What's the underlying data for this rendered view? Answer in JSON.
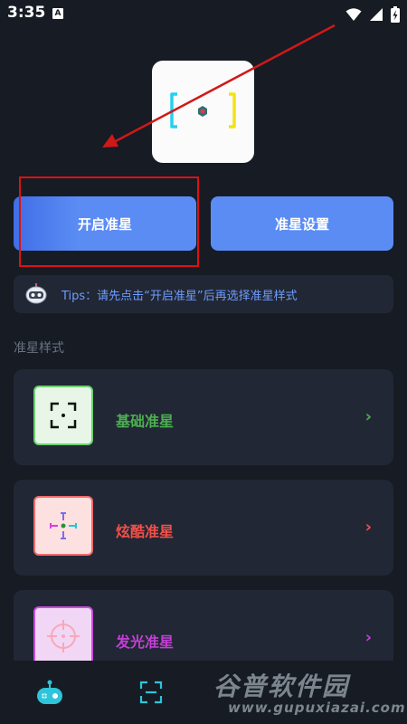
{
  "status_bar": {
    "time": "3:35",
    "notification_badge": "A"
  },
  "buttons": {
    "start_crosshair": "开启准星",
    "crosshair_settings": "准星设置"
  },
  "tips": {
    "text": "Tips：请先点击“开启准星”后再选择准星样式"
  },
  "section": {
    "title": "准星样式"
  },
  "styles": [
    {
      "title": "基础准星",
      "color": "#4caf50",
      "icon_bg": "#e7f6e7",
      "icon_border": "#6fcf6f",
      "chevron": "›"
    },
    {
      "title": "炫酷准星",
      "color": "#f0504a",
      "icon_bg": "#fde0e0",
      "icon_border": "#f06b6b",
      "chevron": "›"
    },
    {
      "title": "发光准星",
      "color": "#c23fd4",
      "icon_bg": "#f1d7f5",
      "icon_border": "#c94ee0",
      "chevron": "›"
    }
  ],
  "watermark": {
    "brand": "谷普软件园",
    "url": "www.gupuxiazai.com"
  },
  "colors": {
    "accent": "#5b8cf4",
    "background": "#161b24",
    "card": "#212734",
    "highlight": "#e01010"
  }
}
